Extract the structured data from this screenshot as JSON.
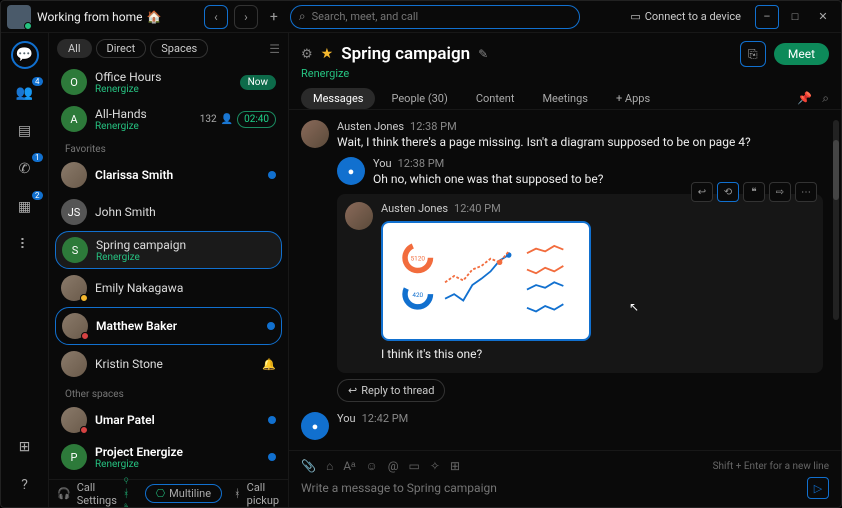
{
  "topbar": {
    "status": "Working from home",
    "status_emoji": "🏠",
    "search_placeholder": "Search, meet, and call",
    "connect": "Connect to a device"
  },
  "rail": {
    "badges": {
      "chat": "",
      "teams": "4",
      "phone": "1",
      "calendar": "2"
    }
  },
  "filters": {
    "all": "All",
    "direct": "Direct",
    "spaces": "Spaces"
  },
  "rooms": [
    {
      "title": "Office Hours",
      "sub": "Renergize",
      "initial": "O",
      "now": true
    },
    {
      "title": "All-Hands",
      "sub": "Renergize",
      "initial": "A",
      "count": "132",
      "time": "02:40"
    }
  ],
  "sections": {
    "favorites": "Favorites",
    "other": "Other spaces"
  },
  "favorites": [
    {
      "title": "Clarissa Smith",
      "bold": true,
      "dot": true,
      "initial": ""
    },
    {
      "title": "John Smith",
      "initial": "JS"
    },
    {
      "title": "Spring campaign",
      "sub": "Renergize",
      "initial": "S",
      "selected": true
    },
    {
      "title": "Emily Nakagawa",
      "initial": ""
    },
    {
      "title": "Matthew Baker",
      "bold": true,
      "dot": true,
      "initial": "",
      "hl": true,
      "pres": "red"
    },
    {
      "title": "Kristin Stone",
      "bell": true,
      "initial": ""
    }
  ],
  "other": [
    {
      "title": "Umar Patel",
      "bold": true,
      "dot": true,
      "initial": "",
      "pres": "red"
    },
    {
      "title": "Project Energize",
      "sub": "Renergize",
      "bold": true,
      "initial": "P",
      "dot": true
    }
  ],
  "callbar": {
    "settings": "Call Settings",
    "multiline": "Multiline",
    "pickup": "Call pickup"
  },
  "space": {
    "title": "Spring campaign",
    "sub": "Renergize",
    "meet": "Meet"
  },
  "tabs": {
    "messages": "Messages",
    "people": "People (30)",
    "content": "Content",
    "meetings": "Meetings",
    "apps": "Apps"
  },
  "msgs": {
    "m1": {
      "name": "Austen Jones",
      "time": "12:38 PM",
      "text": "Wait, I think there's a page missing. Isn't a diagram supposed to be on page 4?"
    },
    "m2": {
      "name": "You",
      "time": "12:38 PM",
      "text": "Oh no, which one was that supposed to be?"
    },
    "m3": {
      "name": "Austen Jones",
      "time": "12:40 PM",
      "text": "I think it's this one?"
    },
    "m4": {
      "name": "You",
      "time": "12:42 PM"
    },
    "reply": "Reply to thread"
  },
  "chart_data": {
    "type": "mixed",
    "series": [
      {
        "name": "donut-a",
        "color": "#f26c3d",
        "value": 5120
      },
      {
        "name": "donut-b",
        "color": "#1170cf",
        "value": 420
      },
      {
        "name": "line-blue",
        "color": "#1170cf",
        "y": [
          30,
          35,
          28,
          42,
          50,
          58,
          72,
          78
        ]
      },
      {
        "name": "line-orange",
        "color": "#f26c3d",
        "y": [
          48,
          55,
          50,
          62,
          66,
          74,
          70,
          80
        ]
      },
      {
        "name": "spark1",
        "color": "#f26c3d",
        "y": [
          4,
          6,
          5,
          7,
          6
        ]
      },
      {
        "name": "spark2",
        "color": "#f26c3d",
        "y": [
          5,
          4,
          6,
          5,
          7
        ]
      },
      {
        "name": "spark3",
        "color": "#1170cf",
        "y": [
          3,
          5,
          4,
          6,
          5
        ]
      },
      {
        "name": "spark4",
        "color": "#1170cf",
        "y": [
          4,
          3,
          5,
          4,
          6
        ]
      }
    ]
  },
  "composer": {
    "hint": "Shift + Enter for a new line",
    "placeholder": "Write a message to Spring campaign"
  }
}
